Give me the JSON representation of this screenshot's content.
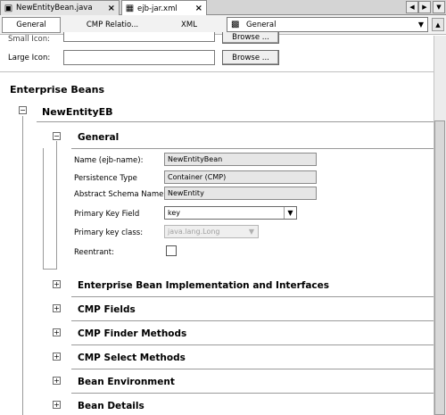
{
  "file_tabs": [
    {
      "label": "NewEntityBean.java",
      "icon": "java-file-icon",
      "active": false
    },
    {
      "label": "ejb-jar.xml",
      "icon": "xml-file-icon",
      "active": true
    }
  ],
  "view_tabs": [
    {
      "label": "General",
      "selected": true
    },
    {
      "label": "CMP Relatio...",
      "selected": false
    },
    {
      "label": "XML",
      "selected": false
    }
  ],
  "view_combo": {
    "value": "General",
    "icon": "ejb-jar-icon"
  },
  "icons": {
    "small_icon_label": "Small Icon:",
    "small_icon_button": "Browse ...",
    "large_icon_label": "Large Icon:",
    "large_icon_value": "",
    "large_icon_button": "Browse ..."
  },
  "enterprise_beans": {
    "title": "Enterprise Beans",
    "bean": {
      "name": "NewEntityEB",
      "general": {
        "title": "General",
        "name_label": "Name (ejb-name):",
        "name_value": "NewEntityBean",
        "persistence_label": "Persistence Type",
        "persistence_value": "Container (CMP)",
        "schema_label": "Abstract Schema Name:",
        "schema_value": "NewEntity",
        "pk_field_label": "Primary Key Field",
        "pk_field_value": "key",
        "pk_class_label": "Primary key class:",
        "pk_class_value": "java.lang.Long",
        "reentrant_label": "Reentrant:",
        "reentrant_checked": false
      },
      "collapsed_sections": [
        "Enterprise Bean Implementation and Interfaces",
        "CMP Fields",
        "CMP Finder Methods",
        "CMP Select Methods",
        "Bean Environment",
        "Bean Details"
      ]
    }
  }
}
